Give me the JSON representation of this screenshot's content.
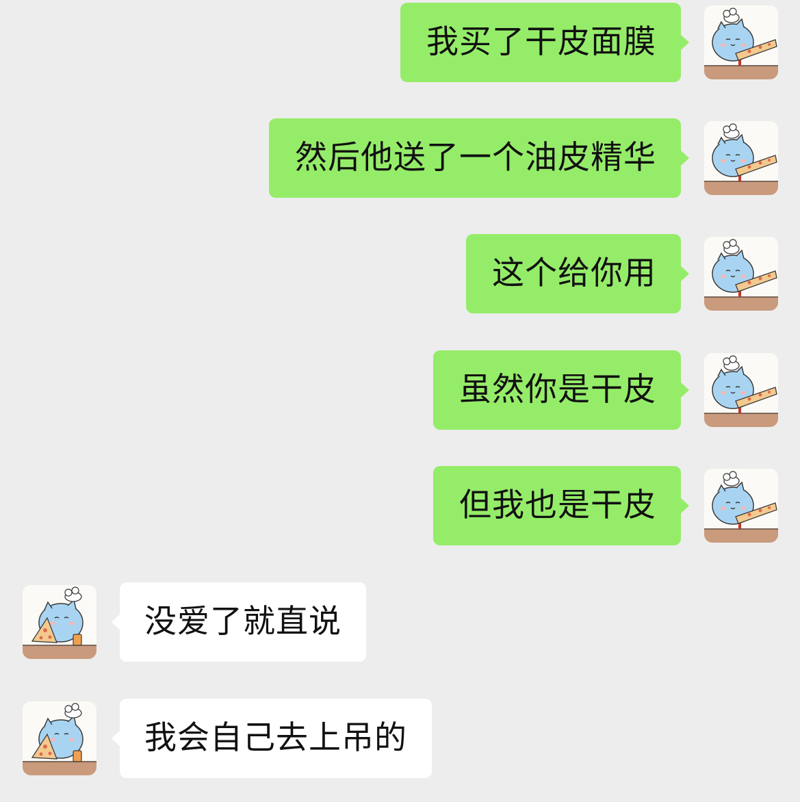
{
  "colors": {
    "background": "#ededed",
    "self_bubble": "#95ec69",
    "other_bubble": "#ffffff",
    "text": "#111111"
  },
  "self_avatar_icon": "chef-cat-with-pizza-icon",
  "other_avatar_icon": "chef-cat-eating-pizza-icon",
  "messages": [
    {
      "sender": "self",
      "text": "我买了干皮面膜"
    },
    {
      "sender": "self",
      "text": "然后他送了一个油皮精华"
    },
    {
      "sender": "self",
      "text": "这个给你用"
    },
    {
      "sender": "self",
      "text": "虽然你是干皮"
    },
    {
      "sender": "self",
      "text": "但我也是干皮"
    },
    {
      "sender": "other",
      "text": "没爱了就直说"
    },
    {
      "sender": "other",
      "text": "我会自己去上吊的"
    }
  ]
}
